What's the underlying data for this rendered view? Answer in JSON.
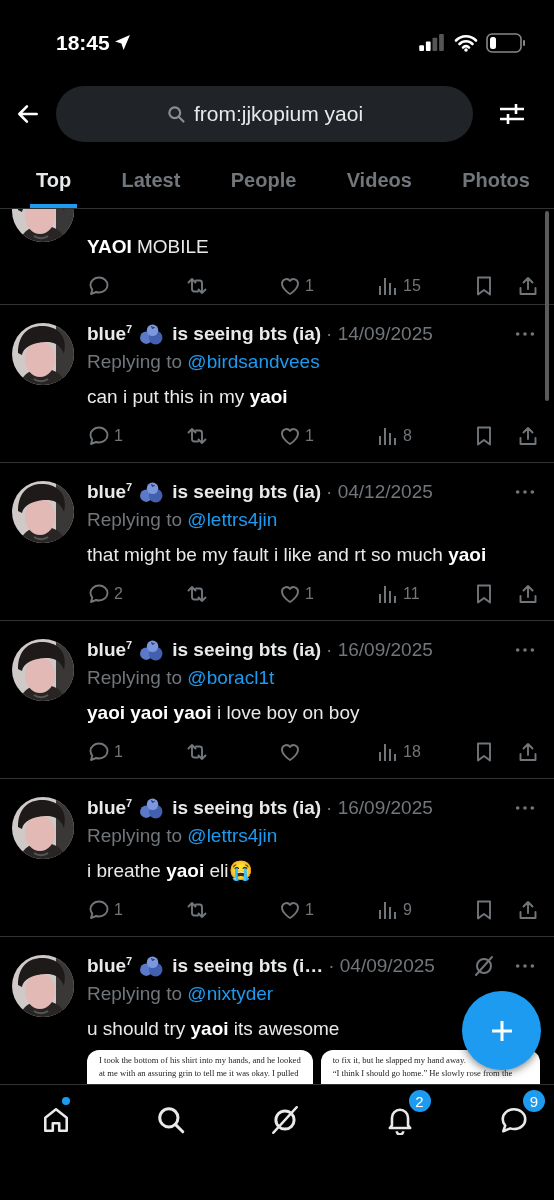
{
  "status_bar": {
    "time": "18:45"
  },
  "search": {
    "value": "from:jjkopium yaoi"
  },
  "tabs": [
    {
      "label": "Top",
      "selected": true
    },
    {
      "label": "Latest",
      "selected": false
    },
    {
      "label": "People",
      "selected": false
    },
    {
      "label": "Videos",
      "selected": false
    },
    {
      "label": "Photos",
      "selected": false
    }
  ],
  "tweets": [
    {
      "kind": "partial",
      "text": "**YAOI** MOBILE",
      "likes": "1",
      "views": "15"
    },
    {
      "kind": "post",
      "name": "blue$^{7}$",
      "name_suffix": "is seeing bts (ia)",
      "date": "· 14/09/2025",
      "reply_prefix": "Replying to",
      "reply_to": "@birdsandvees",
      "text": "can i put this in my **yaoi**",
      "replies": "1",
      "likes": "1",
      "views": "8"
    },
    {
      "kind": "post",
      "name": "blue$^{7}$",
      "name_suffix": "is seeing bts (ia)",
      "date": "· 04/12/2025",
      "reply_prefix": "Replying to",
      "reply_to": "@lettrs4jin",
      "text": "that might be my fault i like and rt so much **yaoi**",
      "replies": "2",
      "likes": "1",
      "views": "11"
    },
    {
      "kind": "post",
      "name": "blue$^{7}$",
      "name_suffix": "is seeing bts (ia)",
      "date": "· 16/09/2025",
      "reply_prefix": "Replying to",
      "reply_to": "@boracl1t",
      "text": "**yaoi yaoi yaoi** i love boy on boy",
      "replies": "1",
      "views": "18"
    },
    {
      "kind": "post",
      "name": "blue$^{7}$",
      "name_suffix": "is seeing bts (ia)",
      "date": "· 16/09/2025",
      "reply_prefix": "Replying to",
      "reply_to": "@lettrs4jin",
      "text": "i breathe **yaoi** eli😭",
      "replies": "1",
      "likes": "1",
      "views": "9"
    },
    {
      "kind": "media",
      "name": "blue$^{7}$",
      "name_suffix": "is seeing bts (i…",
      "date": "· 04/09/2025",
      "reply_prefix": "Replying to",
      "reply_to": "@nixtyder",
      "text": "u should try **yaoi** its awesome",
      "media": [
        {
          "lines": [
            "I took the bottom of his shirt into my hands, and he looked",
            "at me with an assuring grin to tell me it was okay. I pulled"
          ]
        },
        {
          "lines": [
            "to fix it, but he slapped my hand away.",
            "“I think I should go home.” He slowly rose from the"
          ]
        }
      ]
    }
  ],
  "nav": [
    {
      "kind": "home",
      "dot": true
    },
    {
      "kind": "search"
    },
    {
      "kind": "grok"
    },
    {
      "kind": "notifications",
      "badge": "2"
    },
    {
      "kind": "messages",
      "badge": "9"
    }
  ]
}
